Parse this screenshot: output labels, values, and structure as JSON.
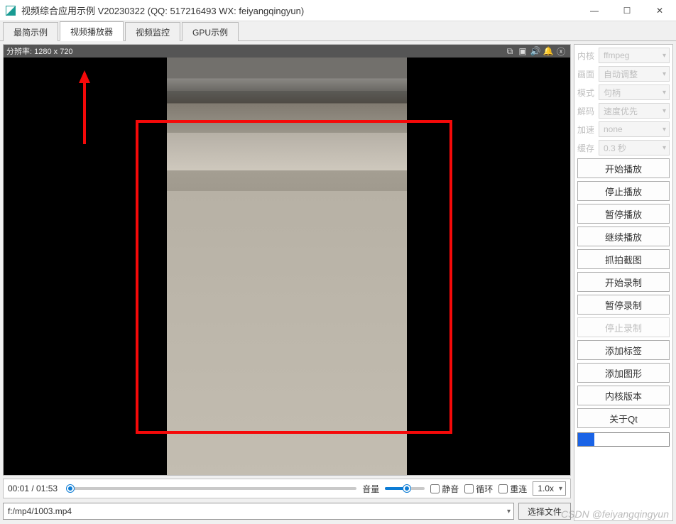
{
  "window": {
    "title": "视频综合应用示例 V20230322 (QQ: 517216493 WX: feiyangqingyun)"
  },
  "tabs": [
    "最简示例",
    "视频播放器",
    "视频监控",
    "GPU示例"
  ],
  "active_tab_index": 1,
  "video": {
    "resolution_label": "分辨率: 1280 x 720",
    "toolbar_icons": [
      "pip-icon",
      "camera-icon",
      "sound-icon",
      "bell-icon",
      "close-icon"
    ]
  },
  "playback": {
    "time": "00:01 / 01:53",
    "seek_percent": 1,
    "volume_label": "音量",
    "volume_percent": 55,
    "mute_label": "静音",
    "loop_label": "循环",
    "reconnect_label": "重连",
    "speed": "1.0x"
  },
  "source": {
    "path": "f:/mp4/1003.mp4",
    "browse_btn": "选择文件"
  },
  "settings": {
    "rows": [
      {
        "label": "内核",
        "value": "ffmpeg"
      },
      {
        "label": "画面",
        "value": "自动调整"
      },
      {
        "label": "模式",
        "value": "句柄"
      },
      {
        "label": "解码",
        "value": "速度优先"
      },
      {
        "label": "加速",
        "value": "none"
      },
      {
        "label": "缓存",
        "value": "0.3 秒"
      }
    ],
    "buttons": [
      {
        "label": "开始播放",
        "disabled": false
      },
      {
        "label": "停止播放",
        "disabled": false
      },
      {
        "label": "暂停播放",
        "disabled": false
      },
      {
        "label": "继续播放",
        "disabled": false
      },
      {
        "label": "抓拍截图",
        "disabled": false
      },
      {
        "label": "开始录制",
        "disabled": false
      },
      {
        "label": "暂停录制",
        "disabled": false
      },
      {
        "label": "停止录制",
        "disabled": true
      },
      {
        "label": "添加标签",
        "disabled": false
      },
      {
        "label": "添加图形",
        "disabled": false
      },
      {
        "label": "内核版本",
        "disabled": false
      },
      {
        "label": "关于Qt",
        "disabled": false
      }
    ],
    "color_hex": "#1a63e6"
  },
  "watermark": "CSDN @feiyangqingyun"
}
